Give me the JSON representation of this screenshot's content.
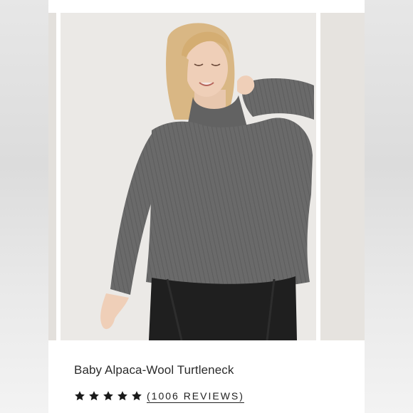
{
  "product": {
    "name": "Baby Alpaca-Wool Turtleneck",
    "image_alt": "Woman wearing a gray turtleneck sweater and black pants",
    "rating": 5,
    "rating_max": 5,
    "reviews_label": "(1006 REVIEWS)"
  },
  "icons": {
    "star": "star-icon"
  },
  "colors": {
    "sweater": "#6b6b6b",
    "pants": "#1f1f1f",
    "background": "#ebe9e6",
    "text": "#2b2b2b"
  }
}
